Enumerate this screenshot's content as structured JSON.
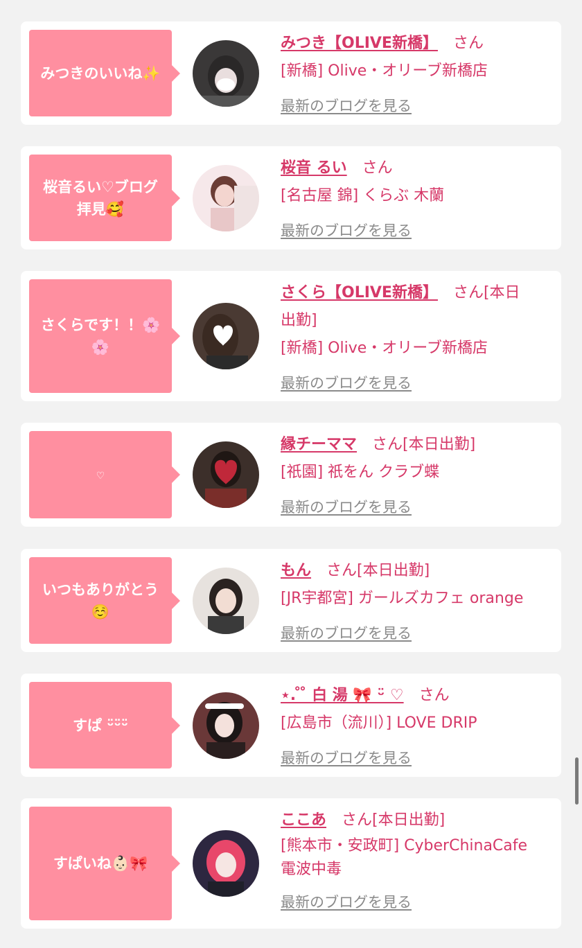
{
  "entries": [
    {
      "bubble_line1": "みつきのいいね✨",
      "bubble_line2": "",
      "name": "みつき【OLIVE新橋】",
      "san": "さん",
      "status": "",
      "store": "[新橋] Olive・オリーブ新橋店",
      "store2": "",
      "link": "最新のブログを見る",
      "avatar_icon": "avatar-photo"
    },
    {
      "bubble_line1": "桜音るい♡ブログ",
      "bubble_line2": "拝見🥰",
      "name": "桜音 るい",
      "san": "さん",
      "status": "",
      "store": "[名古屋 錦] くらぶ 木蘭",
      "store2": "",
      "link": "最新のブログを見る",
      "avatar_icon": "avatar-photo"
    },
    {
      "bubble_line1": "さくらです！！🌸",
      "bubble_line2": "🌸",
      "name": "さくら【OLIVE新橋】",
      "san": "さん[本日",
      "status": "出勤]",
      "store": "[新橋] Olive・オリーブ新橋店",
      "store2": "",
      "link": "最新のブログを見る",
      "avatar_icon": "avatar-photo"
    },
    {
      "bubble_line1": "♡",
      "bubble_line2": "",
      "name": "縁チーママ",
      "san": "さん[本日出勤]",
      "status": "",
      "store": "[祇園] 祇をん クラブ蝶",
      "store2": "",
      "link": "最新のブログを見る",
      "avatar_icon": "avatar-photo"
    },
    {
      "bubble_line1": "いつもありがとう",
      "bubble_line2": "☺️",
      "name": "もん",
      "san": "さん[本日出勤]",
      "status": "",
      "store": "[JR宇都宮] ガールズカフェ orange",
      "store2": "",
      "link": "最新のブログを見る",
      "avatar_icon": "avatar-photo"
    },
    {
      "bubble_line1": "すぱ ᵕ̈ᵕ̈ᵕ̈",
      "bubble_line2": "",
      "name": "⋆. ̊ ̊ 白 湯 🎀 ᵕ̈ ♡",
      "san": "さん",
      "status": "",
      "store": "[広島市（流川）] LOVE DRIP",
      "store2": "",
      "link": "最新のブログを見る",
      "avatar_icon": "avatar-photo"
    },
    {
      "bubble_line1": "すぱいね👶🏻🎀",
      "bubble_line2": "",
      "name": "ここあ",
      "san": "さん[本日出勤]",
      "status": "",
      "store": "[熊本市・安政町] CyberChinaCafe",
      "store2": "電波中毒",
      "link": "最新のブログを見る",
      "avatar_icon": "avatar-photo"
    }
  ],
  "colors": {
    "accent": "#d63868",
    "bubble": "#ff8fa0",
    "link": "#8a8a8a",
    "background": "#f2f2f2"
  }
}
